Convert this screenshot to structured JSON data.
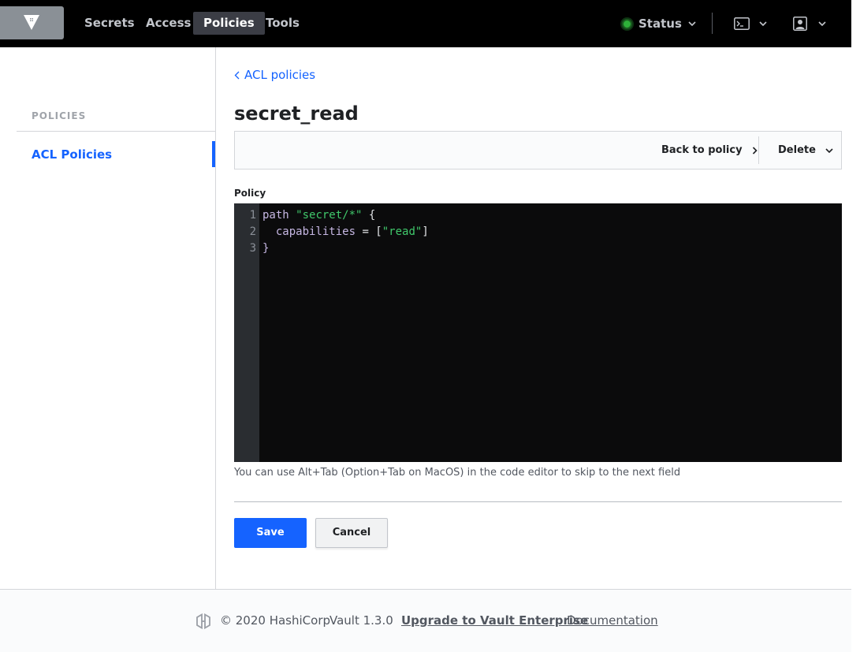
{
  "nav": {
    "items": [
      {
        "label": "Secrets",
        "active": false
      },
      {
        "label": "Access",
        "active": false
      },
      {
        "label": "Policies",
        "active": true
      },
      {
        "label": "Tools",
        "active": false
      }
    ],
    "status_label": "Status",
    "status_color": "#2eb039",
    "console_icon": "terminal-icon",
    "user_icon": "user-square-icon",
    "logo_icon": "vault-logo-icon"
  },
  "sidebar": {
    "heading": "POLICIES",
    "items": [
      {
        "label": "ACL Policies",
        "active": true
      }
    ]
  },
  "main": {
    "breadcrumb": "ACL policies",
    "title": "secret_read",
    "toolbar": {
      "back_label": "Back to policy",
      "delete_label": "Delete"
    },
    "field_label": "Policy",
    "code_lines": [
      {
        "num": "1",
        "parts": [
          {
            "t": "kw",
            "v": "path "
          },
          {
            "t": "str",
            "v": "\"secret/*\""
          },
          {
            "t": "plain",
            "v": " {"
          }
        ]
      },
      {
        "num": "2",
        "parts": [
          {
            "t": "kw",
            "v": "  capabilities "
          },
          {
            "t": "plain",
            "v": "= ["
          },
          {
            "t": "str",
            "v": "\"read\""
          },
          {
            "t": "plain",
            "v": "]"
          }
        ]
      },
      {
        "num": "3",
        "parts": [
          {
            "t": "kw",
            "v": "}"
          }
        ]
      }
    ],
    "help_text": "You can use Alt+Tab (Option+Tab on MacOS) in the code editor to skip to the next field",
    "save_label": "Save",
    "cancel_label": "Cancel",
    "accent_color": "#1563ff"
  },
  "footer": {
    "copyright": "© 2020 HashiCorp",
    "version": "Vault 1.3.0",
    "upgrade_link": "Upgrade to Vault Enterprise",
    "docs_link": "Documentation",
    "logo_icon": "hashicorp-logo-icon"
  }
}
